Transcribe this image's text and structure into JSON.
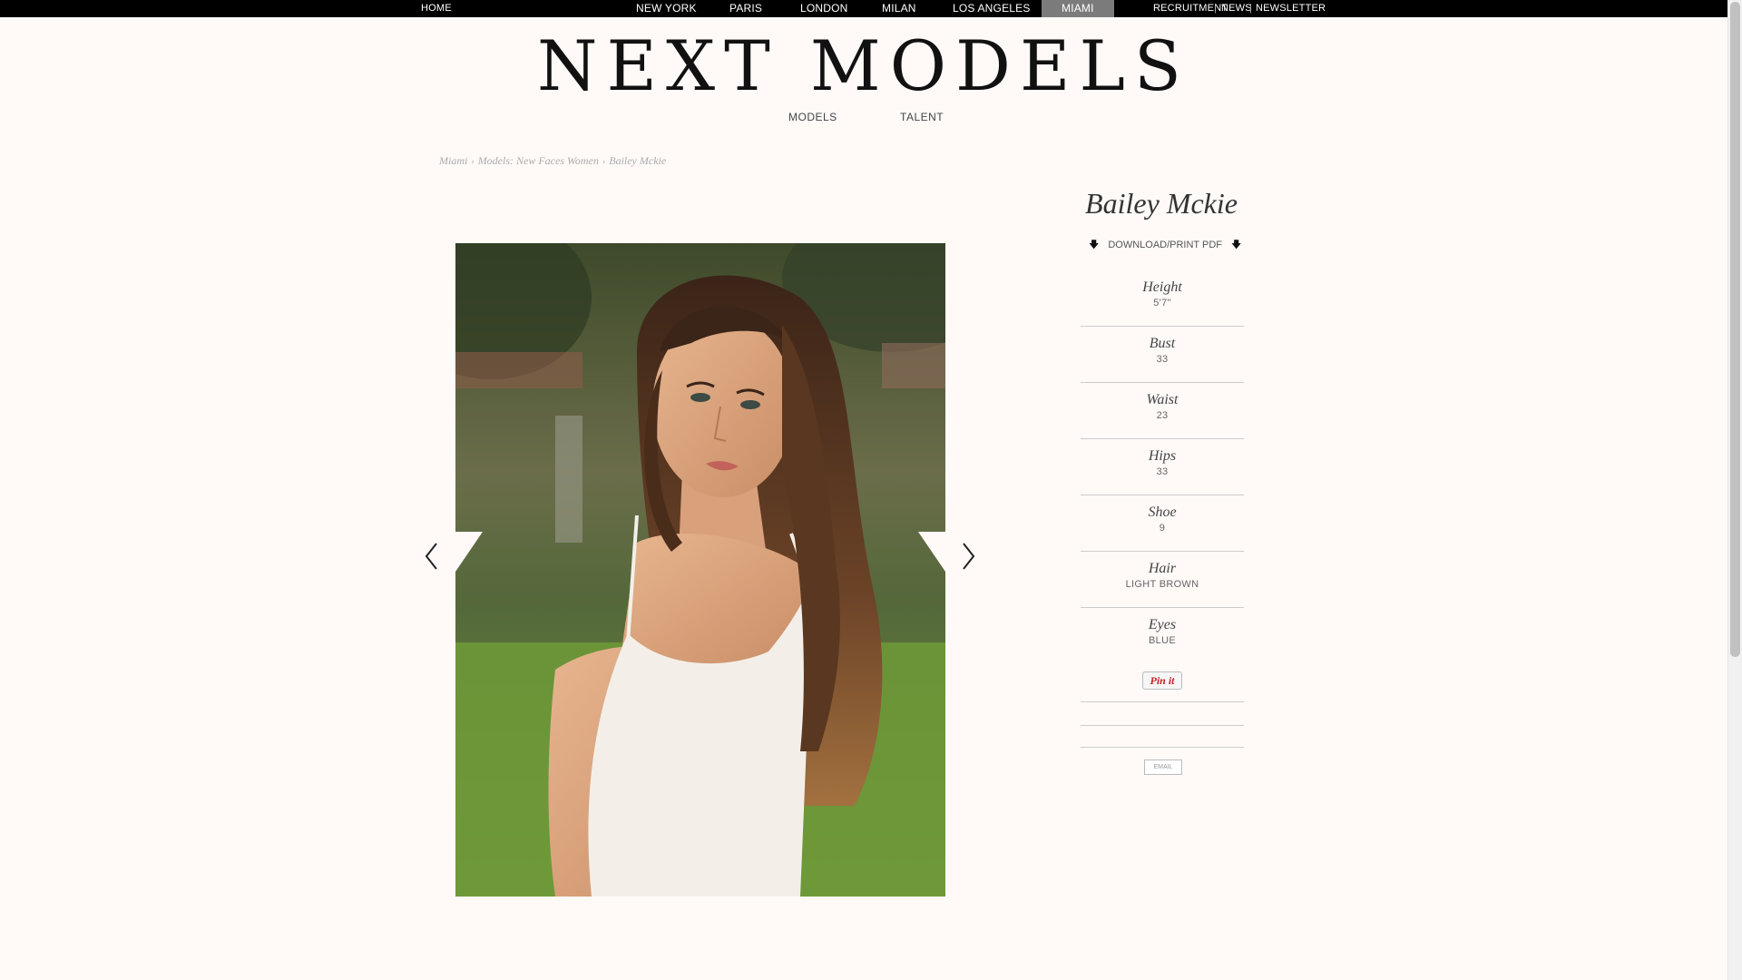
{
  "topbar": {
    "home": "HOME",
    "cities": [
      "NEW YORK",
      "PARIS",
      "LONDON",
      "MILAN",
      "LOS ANGELES",
      "MIAMI"
    ],
    "active_city": "MIAMI",
    "right_links": [
      "RECRUITMENT",
      "NEWS",
      "NEWSLETTER"
    ],
    "separator": "|"
  },
  "logo": "NEXT MODELS",
  "mainnav": [
    "MODELS",
    "TALENT"
  ],
  "breadcrumb": [
    "Miami",
    "Models: New Faces Women",
    "Bailey Mckie"
  ],
  "breadcrumb_separator": "›",
  "model": {
    "name": "Bailey Mckie",
    "pdf_label": "DOWNLOAD/PRINT PDF",
    "download_glyph": "🡇"
  },
  "stats": [
    {
      "label": "Height",
      "value": "5'7\""
    },
    {
      "label": "Bust",
      "value": "33"
    },
    {
      "label": "Waist",
      "value": "23"
    },
    {
      "label": "Hips",
      "value": "33"
    },
    {
      "label": "Shoe",
      "value": "9"
    },
    {
      "label": "Hair",
      "value": "LIGHT BROWN"
    },
    {
      "label": "Eyes",
      "value": "BLUE"
    }
  ],
  "pinit_label": "Pin it",
  "email_label": "EMAIL",
  "colors": {
    "background": "#fffaf8",
    "topbar": "#000000",
    "active_tab": "#7b7b7b",
    "pinit_red": "#c8232c"
  },
  "icons": {
    "prev": "chevron-left-icon",
    "next": "chevron-right-icon",
    "download": "download-arrow-icon"
  }
}
